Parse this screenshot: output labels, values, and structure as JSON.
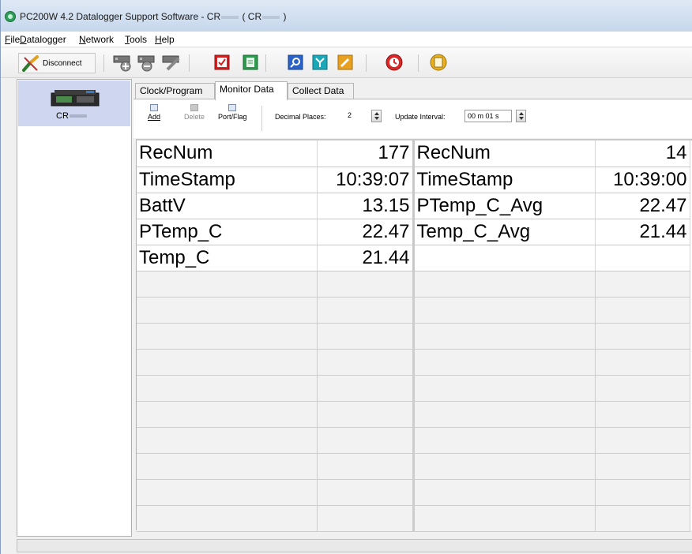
{
  "window": {
    "title_prefix": "PC200W 4.2 Datalogger Support Software - CR",
    "title_mid": " ( CR",
    "title_suffix": " )"
  },
  "menu": [
    {
      "label": "File",
      "accel": "F",
      "rest": "ile"
    },
    {
      "label": "Datalogger",
      "accel": "D",
      "rest": "atalogger"
    },
    {
      "label": "Network",
      "accel": "N",
      "rest": "etwork"
    },
    {
      "label": "Tools",
      "accel": "T",
      "rest": "ools"
    },
    {
      "label": "Help",
      "accel": "H",
      "rest": "elp"
    }
  ],
  "toolbar": {
    "disconnect_label": "Disconnect",
    "icons": [
      "add-datalogger-icon",
      "remove-datalogger-icon",
      "setup-icon",
      "checklist-icon",
      "file-icon",
      "search-icon",
      "network-icon",
      "edit-icon",
      "clock-icon",
      "notes-icon"
    ]
  },
  "station": {
    "name": "CR"
  },
  "tabs": [
    {
      "label": "Clock/Program",
      "active": false
    },
    {
      "label": "Monitor Data",
      "active": true
    },
    {
      "label": "Collect Data",
      "active": false
    }
  ],
  "monitor": {
    "add_label": "Add",
    "delete_label": "Delete",
    "portflag_label": "Port/Flag",
    "decimal_label": "Decimal Places:",
    "decimal_value": "2",
    "interval_label": "Update Interval:",
    "interval_value": "00 m 01 s"
  },
  "grid": {
    "rows": [
      {
        "n1": "RecNum",
        "v1": "177",
        "n2": "RecNum",
        "v2": "14"
      },
      {
        "n1": "TimeStamp",
        "v1": "10:39:07",
        "n2": "TimeStamp",
        "v2": "10:39:00"
      },
      {
        "n1": "BattV",
        "v1": "13.15",
        "n2": "PTemp_C_Avg",
        "v2": "22.47"
      },
      {
        "n1": "PTemp_C",
        "v1": "22.47",
        "n2": "Temp_C_Avg",
        "v2": "21.44"
      },
      {
        "n1": "Temp_C",
        "v1": "21.44",
        "n2": "",
        "v2": ""
      }
    ],
    "empty_rows": 10
  }
}
